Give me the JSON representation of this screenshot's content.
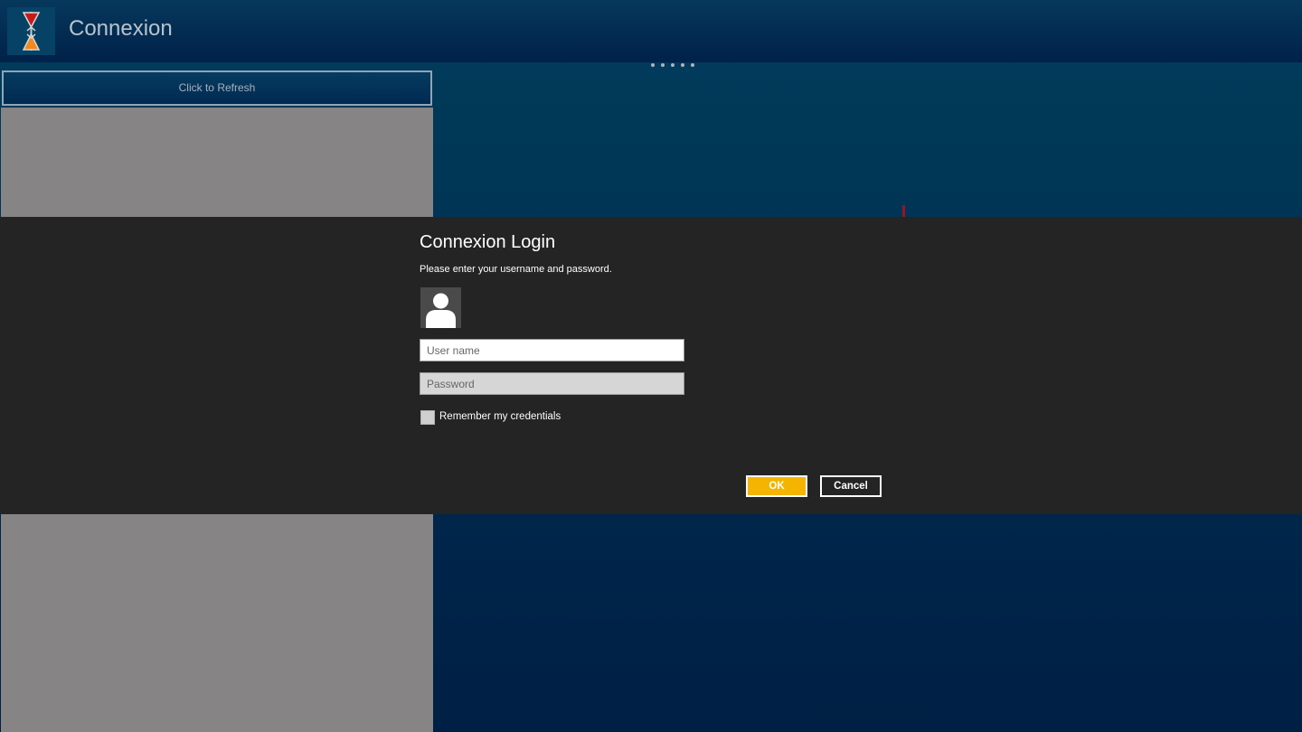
{
  "app": {
    "title": "Connexion",
    "refresh_label": "Click to Refresh"
  },
  "loading_dots": 5,
  "login_dialog": {
    "title": "Connexion Login",
    "subtitle": "Please enter your username and password.",
    "username": {
      "value": "",
      "placeholder": "User name"
    },
    "password": {
      "value": "",
      "placeholder": "Password"
    },
    "remember": {
      "label": "Remember my credentials",
      "checked": false
    },
    "ok_label": "OK",
    "cancel_label": "Cancel"
  },
  "icons": {
    "logo": "connexion-logo-icon",
    "avatar": "user-avatar-icon"
  },
  "colors": {
    "accent": "#f4b400",
    "dialog_background": "#242424",
    "panel_gray": "#878485",
    "header_blue": "#00214a"
  }
}
